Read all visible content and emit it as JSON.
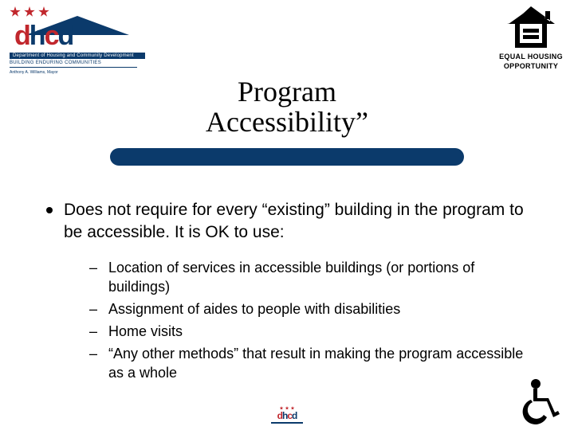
{
  "logos": {
    "dhcd": {
      "word_d1": "d",
      "word_h": "h",
      "word_c": "c",
      "word_d2": "d",
      "strip": "Department of Housing and Community Development",
      "tagline": "BUILDING ENDURING COMMUNITIES",
      "sub": "Anthony A. Williams, Mayor"
    },
    "eho": {
      "line1": "EQUAL HOUSING",
      "line2": "OPPORTUNITY"
    }
  },
  "title": {
    "line1": "Program",
    "line2": "Accessibility”"
  },
  "content": {
    "lead": "Does not require for every “existing” building in the program to be accessible.  It is OK to use:",
    "items": [
      "Location of services in accessible buildings (or portions of buildings)",
      "Assignment of aides to people with disabilities",
      "Home visits",
      "“Any other methods” that result in making the program accessible as a whole"
    ]
  }
}
